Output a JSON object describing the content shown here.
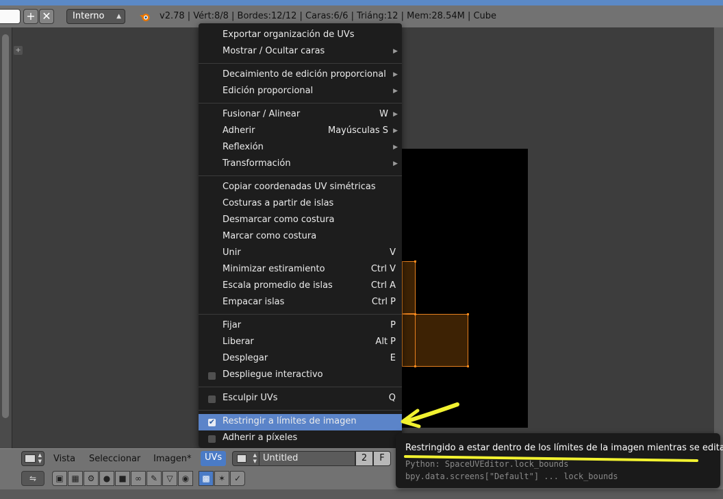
{
  "top_header": {
    "engine": "Interno",
    "stats": "v2.78 | Vért:8/8 | Bordes:12/12 | Caras:6/6 | Triáng:12 | Mem:28.54M | Cube",
    "add_icon": "plus-icon",
    "remove_icon": "close-icon"
  },
  "uv_menu": {
    "items": [
      {
        "label": "Exportar organización de UVs",
        "shortcut": "",
        "submenu": false
      },
      {
        "label": "Mostrar / Ocultar caras",
        "shortcut": "",
        "submenu": true
      },
      {
        "label": "Decaimiento de edición proporcional",
        "shortcut": "",
        "submenu": true
      },
      {
        "label": "Edición proporcional",
        "shortcut": "",
        "submenu": true
      },
      {
        "label": "Fusionar / Alinear",
        "shortcut": "W",
        "submenu": true
      },
      {
        "label": "Adherir",
        "shortcut": "Mayúsculas S",
        "submenu": true
      },
      {
        "label": "Reflexión",
        "shortcut": "",
        "submenu": true
      },
      {
        "label": "Transformación",
        "shortcut": "",
        "submenu": true
      },
      {
        "label": "Copiar coordenadas UV simétricas",
        "shortcut": "",
        "submenu": false
      },
      {
        "label": "Costuras a partir de islas",
        "shortcut": "",
        "submenu": false
      },
      {
        "label": "Desmarcar como costura",
        "shortcut": "",
        "submenu": false
      },
      {
        "label": "Marcar como costura",
        "shortcut": "",
        "submenu": false
      },
      {
        "label": "Unir",
        "shortcut": "V",
        "submenu": false
      },
      {
        "label": "Minimizar estiramiento",
        "shortcut": "Ctrl V",
        "submenu": false
      },
      {
        "label": "Escala promedio de islas",
        "shortcut": "Ctrl A",
        "submenu": false
      },
      {
        "label": "Empacar islas",
        "shortcut": "Ctrl P",
        "submenu": false
      },
      {
        "label": "Fijar",
        "shortcut": "P",
        "submenu": false
      },
      {
        "label": "Liberar",
        "shortcut": "Alt P",
        "submenu": false
      },
      {
        "label": "Desplegar",
        "shortcut": "E",
        "submenu": false
      },
      {
        "label": "Despliegue interactivo",
        "shortcut": "",
        "checkbox": true,
        "checked": false
      },
      {
        "label": "Esculpir UVs",
        "shortcut": "Q",
        "checkbox": true,
        "checked": false
      },
      {
        "label": "Restringir a límites de imagen",
        "shortcut": "",
        "checkbox": true,
        "checked": true,
        "highlighted": true
      },
      {
        "label": "Adherir a píxeles",
        "shortcut": "",
        "checkbox": true,
        "checked": false
      }
    ],
    "check_mark": "✔"
  },
  "tooltip": {
    "title": "Restringido a estar dentro de los límites de la imagen mientras se edita",
    "python": "Python: SpaceUVEditor.lock_bounds",
    "path": "bpy.data.screens[\"Default\"] ... lock_bounds"
  },
  "editor_header": {
    "menus": [
      "Vista",
      "Seleccionar",
      "Imagen*",
      "UVs"
    ],
    "active_menu": "UVs",
    "image_name": "Untitled",
    "users": "2",
    "fake_user": "F"
  },
  "annotation_color": "#f2f230",
  "accent": "#5b84c9"
}
